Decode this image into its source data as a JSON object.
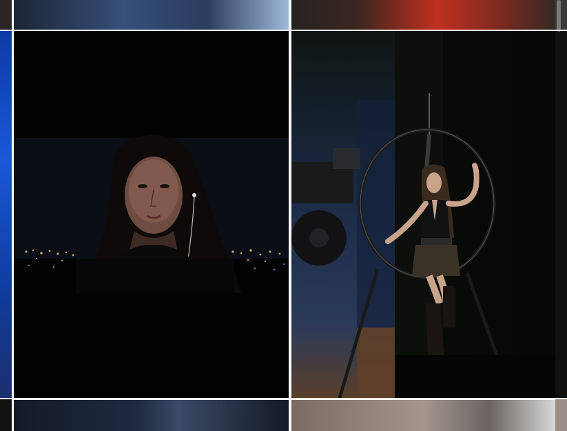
{
  "feed": {
    "tiles": [
      {
        "id": "top-left",
        "caption": ""
      },
      {
        "id": "top-right",
        "caption": ""
      },
      {
        "id": "selfie",
        "caption": ""
      },
      {
        "id": "stage",
        "caption": ""
      },
      {
        "id": "bottom-left",
        "caption": ""
      },
      {
        "id": "bottom-right",
        "caption": ""
      }
    ],
    "gutter_color": "#ffffff"
  },
  "palette": {
    "selfie_background": "#020202",
    "stage_background": "#06080a",
    "left_strip_blue": "#1b57d8"
  },
  "icons": [
    "scrollbar-thumb"
  ]
}
